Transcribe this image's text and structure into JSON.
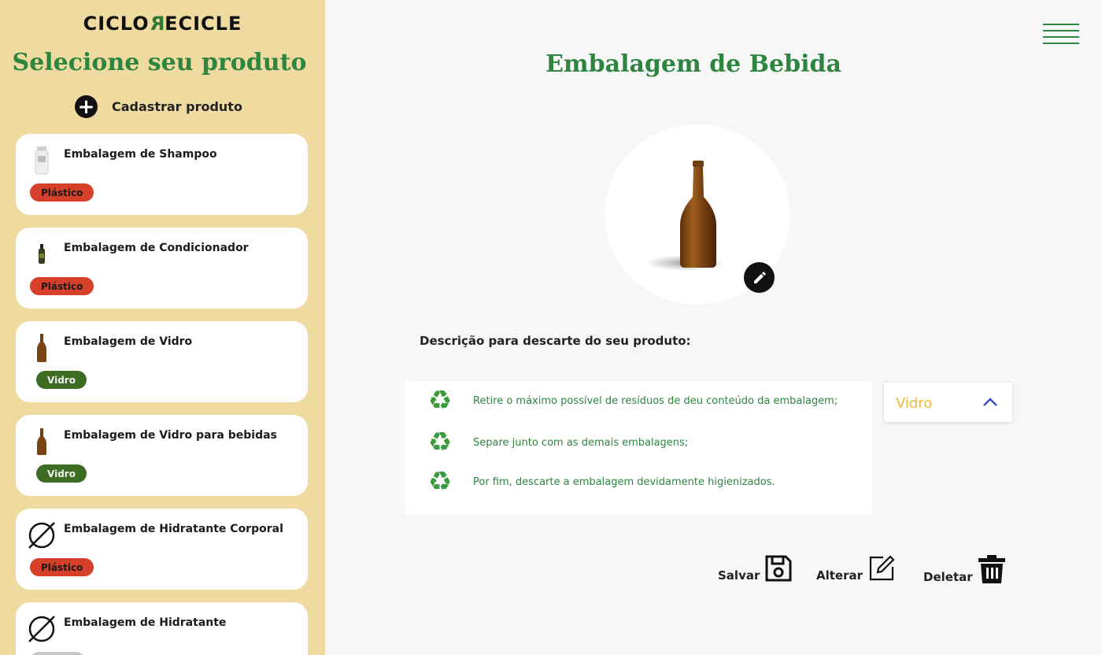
{
  "brand": {
    "part1": "CICLO",
    "part2": "R",
    "part3": "ECICLE"
  },
  "sidebar": {
    "title": "Selecione seu produto",
    "add_label": "Cadastrar produto",
    "products": [
      {
        "name": "Embalagem de Shampoo",
        "material": "Plástico",
        "thumb": "shampoo-bottle"
      },
      {
        "name": "Embalagem de Condicionador",
        "material": "Plástico",
        "thumb": "small-bottle"
      },
      {
        "name": "Embalagem de Vidro",
        "material": "Vidro",
        "thumb": "glass-bottle"
      },
      {
        "name": "Embalagem de Vidro para bebidas",
        "material": "Vidro",
        "thumb": "glass-bottle"
      },
      {
        "name": "Embalagem de Hidratante Corporal",
        "material": "Plástico",
        "thumb": "no-image-icon"
      },
      {
        "name": "Embalagem de Hidratante",
        "material": "",
        "thumb": "no-image-icon"
      }
    ]
  },
  "main": {
    "title": "Embalagem de Bebida",
    "description_label": "Descrição para descarte do seu produto:",
    "steps": [
      "Retire o máximo possível de resíduos de deu conteúdo da embalagem;",
      "Separe junto com as demais embalagens;",
      "Por fim, descarte a embalagem devidamente higienizados."
    ],
    "material_select": {
      "value": "Vidro"
    },
    "actions": {
      "save": "Salvar",
      "edit": "Alterar",
      "delete": "Deletar"
    }
  },
  "colors": {
    "sidebar_bg": "#efdba0",
    "accent_green": "#2e8540",
    "plastic_badge": "#d6402a",
    "glass_badge": "#3d6d23",
    "select_text": "#f0b93a"
  }
}
